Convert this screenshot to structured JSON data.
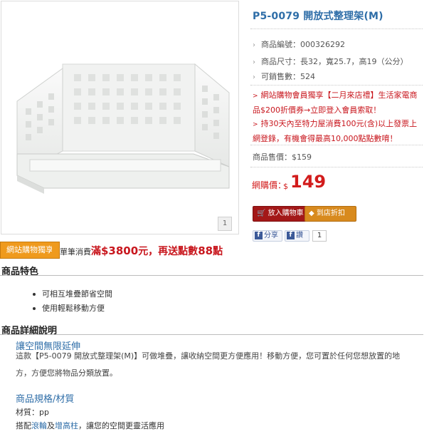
{
  "product": {
    "title": "P5-0079 開放式整理架(M)",
    "image_index": "1",
    "specs": [
      "商品編號：000326292",
      "商品尺寸：長32，寬25.7，高19（公分）",
      "可銷售數：524"
    ],
    "promos": [
      {
        "line1": "網站購物會員獨享【二月來店禮】生活家電商",
        "line2": "品$200折價券→立即登入會員索取！"
      },
      {
        "line1": "持30天內至特力屋消費100元(含)以上發票上",
        "line2": "網登錄，有機會得最高10,000點點數唷！"
      }
    ],
    "list_price": "商品售價：$159",
    "sale_label": "網購價：",
    "sale_currency": "$",
    "sale_price": "149",
    "buttons": {
      "cart": "放入購物車",
      "coupon": "到店折扣券"
    },
    "share": {
      "fb_share": "分享",
      "fb_like": "讚",
      "like_count": "1"
    }
  },
  "banner": {
    "badge": "網站購物獨享",
    "pre": "單筆消費",
    "amount_prefix": "滿",
    "amount": "$3800",
    "mid": "元，再送點數",
    "points": "88",
    "suffix": "點"
  },
  "features": {
    "heading": "商品特色",
    "items": [
      "可相互堆疊節省空間",
      "使用輕鬆移動方便"
    ]
  },
  "details": {
    "heading": "商品詳細說明",
    "sub1": "讓空間無限延伸",
    "para1_line1": "這款【P5-0079 開放式整理架(M)】可做堆疊，讓收納空間更方便應用！移動方便，您可置於任何您想放置的地",
    "para1_line2": "方，方便您將物品分類放置。",
    "sub2": "商品規格/材質",
    "material": "材質：pp",
    "combo_pre": "搭配",
    "combo_link1": "滾輪",
    "combo_and": "及",
    "combo_link2": "增高柱",
    "combo_post": "，讓您的空間更靈活應用"
  },
  "colors": {
    "accent_red": "#c8161d",
    "title_blue": "#2f6ea8",
    "badge_orange": "#ef9a1d",
    "cart_red": "#a31818"
  }
}
